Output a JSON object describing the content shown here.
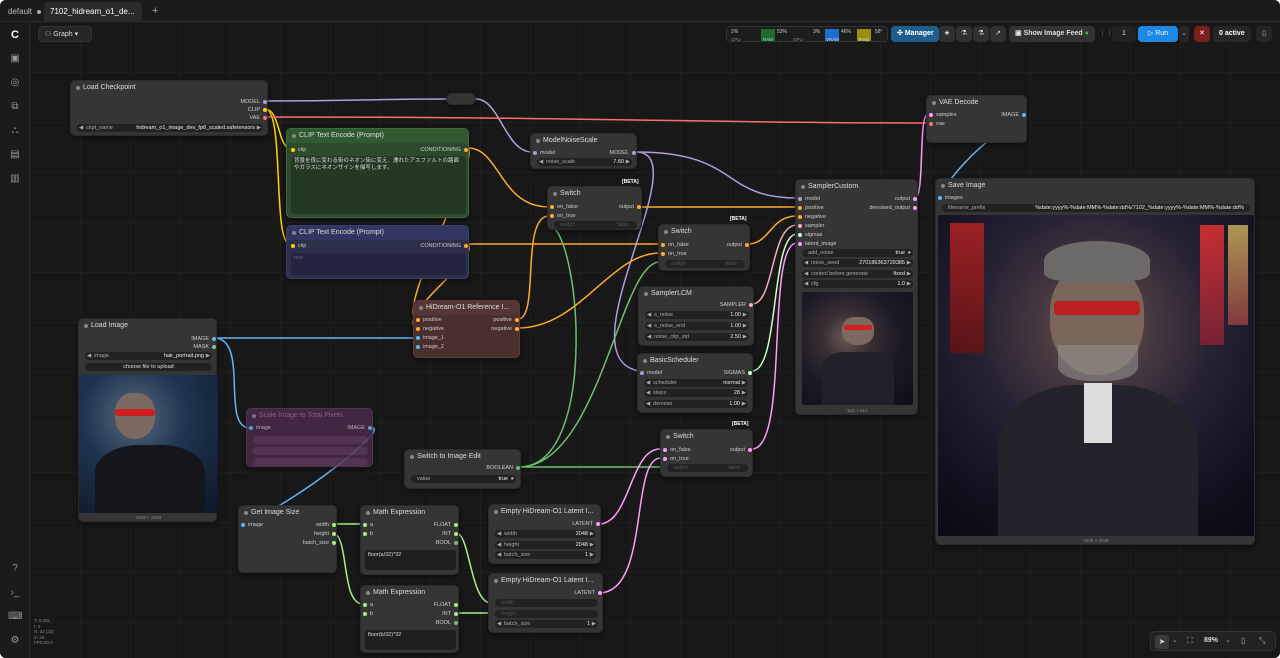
{
  "tabs": [
    {
      "label": "default"
    },
    {
      "label": "7102_hidream_o1_de..."
    }
  ],
  "graph_menu": "Graph",
  "stats": {
    "cpu_label": "CPU",
    "cpu_value": "2%",
    "ram_label": "RAM",
    "ram_value": "53%",
    "gpu_label": "GPU",
    "gpu_value": "3%",
    "vram_label": "VRAM",
    "vram_value": "46%",
    "temp_label": "Temp",
    "temp_value": "58°"
  },
  "manager_label": "Manager",
  "feed_label": "Show Image Feed",
  "queue_count": "1",
  "run_label": "Run",
  "active_label": "0 active",
  "zoom_label": "89%",
  "fps_text": [
    "T: 0.00s",
    "I: 0",
    "N: 22 [22]",
    "V: 44",
    "FPS:60.0"
  ],
  "colors": {
    "model": "#b39ddb",
    "clip": "#ffd500",
    "vae": "#ff6e6e",
    "cond": "#ffa931",
    "latent": "#ff9cf9",
    "image": "#64b5f6",
    "float": "#aaee88",
    "int": "#29699c",
    "sampler": "#ecb4b4",
    "sigmas": "#cdffcd",
    "bool": "#6cc070",
    "green_node": "#2e4a2e",
    "blue_node": "#2c2f4a",
    "brown_node": "#4a2f2f",
    "purple_node": "#4a2a4a",
    "run_blue": "#1e88e5"
  },
  "nodes": {
    "load_checkpoint": {
      "title": "Load Checkpoint",
      "out_model": "MODEL",
      "out_clip": "CLIP",
      "out_vae": "VAE",
      "ckpt_label": "ckpt_name",
      "ckpt_value": "hidream_o1_image_dev_fp8_scaled.safetensors"
    },
    "clip_pos": {
      "title": "CLIP Text Encode (Prompt)",
      "in_clip": "clip",
      "out": "CONDITIONING",
      "text": "背景を夜に変わる街のネオン街に変え、濡れたアスファルトの路面やガラスにネオンサインを描写します。"
    },
    "clip_neg": {
      "title": "CLIP Text Encode (Prompt)",
      "in_clip": "clip",
      "out": "CONDITIONING",
      "text": "text"
    },
    "model_noise": {
      "title": "ModelNoiseScale",
      "in_model": "model",
      "out_model": "MODEL",
      "w_label": "noise_scale",
      "w_value": "7.60"
    },
    "switch1": {
      "title": "Switch",
      "beta": "[BETA]",
      "in1": "on_false",
      "in2": "on_true",
      "out": "output",
      "w_label": "switch",
      "w_value": "false"
    },
    "switch2": {
      "title": "Switch",
      "beta": "[BETA]",
      "in1": "on_false",
      "in2": "on_true",
      "out": "output",
      "w_label": "switch",
      "w_value": "false"
    },
    "switch3": {
      "title": "Switch",
      "beta": "[BETA]",
      "in1": "on_false",
      "in2": "on_true",
      "out": "output",
      "w_label": "switch",
      "w_value": "false"
    },
    "ref_node": {
      "title": "HiDream-O1 Reference I...",
      "in1": "positive",
      "in2": "negative",
      "in3": "image_1",
      "in4": "image_2",
      "out1": "positive",
      "out2": "negative"
    },
    "sampler_lcm": {
      "title": "SamplerLCM",
      "out": "SAMPLER",
      "w1_label": "s_noise",
      "w1_value": "1.00",
      "w2_label": "s_noise_end",
      "w2_value": "1.00",
      "w3_label": "noise_clip_std",
      "w3_value": "2.50"
    },
    "basic_sched": {
      "title": "BasicScheduler",
      "in": "model",
      "out": "SIGMAS",
      "w1_label": "scheduler",
      "w1_value": "normal",
      "w2_label": "steps",
      "w2_value": "28",
      "w3_label": "denoise",
      "w3_value": "1.00"
    },
    "sampler_custom": {
      "title": "SamplerCustom",
      "in1": "model",
      "in2": "positive",
      "in3": "negative",
      "in4": "sampler",
      "in5": "sigmas",
      "in6": "latent_image",
      "out1": "output",
      "out2": "denoised_output",
      "w1_label": "add_noise",
      "w1_value": "true",
      "w2_label": "noise_seed",
      "w2_value": "270186363729385",
      "w3_label": "control before generate",
      "w3_value": "fixed",
      "w4_label": "cfg",
      "w4_value": "1.0",
      "caption": "512 × 512"
    },
    "vae_decode": {
      "title": "VAE Decode",
      "in1": "samples",
      "in2": "vae",
      "out": "IMAGE"
    },
    "save_image": {
      "title": "Save Image",
      "in": "images",
      "w_label": "filename_prefix",
      "w_value": "%date:yyyy%-%date:MM%-%date:dd%/7102_%date:yyyy%-%date:MM%-%date:dd%",
      "caption": "2048 × 2048"
    },
    "load_image": {
      "title": "Load Image",
      "out1": "IMAGE",
      "out2": "MASK",
      "w_label": "image",
      "w_value": "hair_portrait.png",
      "upload": "choose file to upload",
      "caption": "2048 × 2048"
    },
    "scale_image": {
      "title": "Scale Image to Total Pixels",
      "in": "image",
      "out": "IMAGE"
    },
    "switch_edit": {
      "title": "Switch to Image Edit",
      "out": "BOOLEAN",
      "w_label": "value",
      "w_value": "true"
    },
    "get_size": {
      "title": "Get Image Size",
      "in": "image",
      "out1": "width",
      "out2": "height",
      "out3": "batch_size"
    },
    "math1": {
      "title": "Math Expression",
      "in1": "a",
      "in2": "b",
      "out1": "FLOAT",
      "out2": "INT",
      "out3": "BOOL",
      "expr": "floor(a/32)*32"
    },
    "math2": {
      "title": "Math Expression",
      "in1": "a",
      "in2": "b",
      "out1": "FLOAT",
      "out2": "INT",
      "out3": "BOOL",
      "expr": "floor(b/32)*32"
    },
    "latent1": {
      "title": "Empty HiDream-O1 Latent I...",
      "out": "LATENT",
      "w1_label": "width",
      "w1_value": "2048",
      "w2_label": "height",
      "w2_value": "2048",
      "w3_label": "batch_size",
      "w3_value": "1"
    },
    "latent2": {
      "title": "Empty HiDream-O1 Latent I...",
      "out": "LATENT",
      "w1_label": "width",
      "w2_label": "height",
      "w3_label": "batch_size",
      "w3_value": "1"
    }
  }
}
